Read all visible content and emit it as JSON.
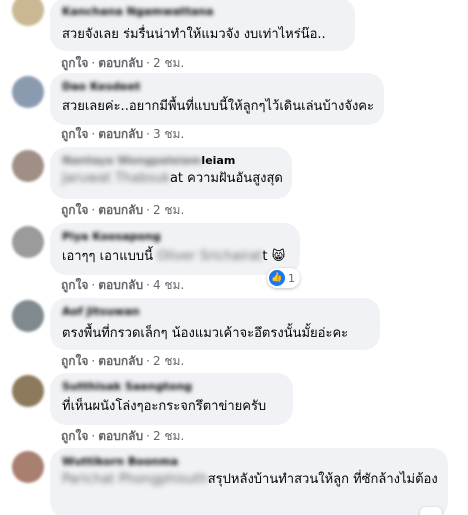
{
  "actions": {
    "like": "ถูกใจ",
    "reply": "ตอบกลับ",
    "dot": "·"
  },
  "comments": [
    {
      "author": "Kanchana Ngamwattana",
      "text": "สวยจังเลย ร่มรื่นน่าทำให้แมวจัง งบเท่าไหร่น๊อ..",
      "time": "2 ชม."
    },
    {
      "author": "Dao Kesdeet",
      "text": "สวยเลยค่ะ..อยากมีพื้นที่แบบนี้ให้ลูกๆไว้เดินเล่นบ้างจังคะ",
      "time": "3 ชม."
    },
    {
      "author": "Nantaya Wongpaleiam",
      "mention": "Jaruwat Thabsuk",
      "text_visible_tail": "leiam",
      "text": "at ความฝันอันสูงสุด",
      "time": "2 ชม."
    },
    {
      "author": "Piya Koosapong",
      "text_prefix": "เอาๆๆ เอาแบบนี้",
      "mention": "Oliver Srichairat",
      "text_suffix": "t",
      "emoji": "😸",
      "time": "4 ชม.",
      "reaction_count": "1"
    },
    {
      "author": "Aof Jitsuwan",
      "text": "ตรงพื้นที่กรวดเล็กๆ น้องแมวเค้าจะอึตรงนั้นมั้ยอ่ะคะ",
      "time": "2 ชม."
    },
    {
      "author": "Sutthisak Saengtong",
      "text": "ที่เห็นผนังโล่งๆอะกระจกรึตาข่ายครับ",
      "time": "2 ชม."
    },
    {
      "author": "Wuttikorn Boonma",
      "mention": "Parichat Phongphisuth",
      "text": "สรุปหลังบ้านทำสวนให้ลูก ที่ซักล้างไม่ต้อง",
      "time": ""
    }
  ]
}
